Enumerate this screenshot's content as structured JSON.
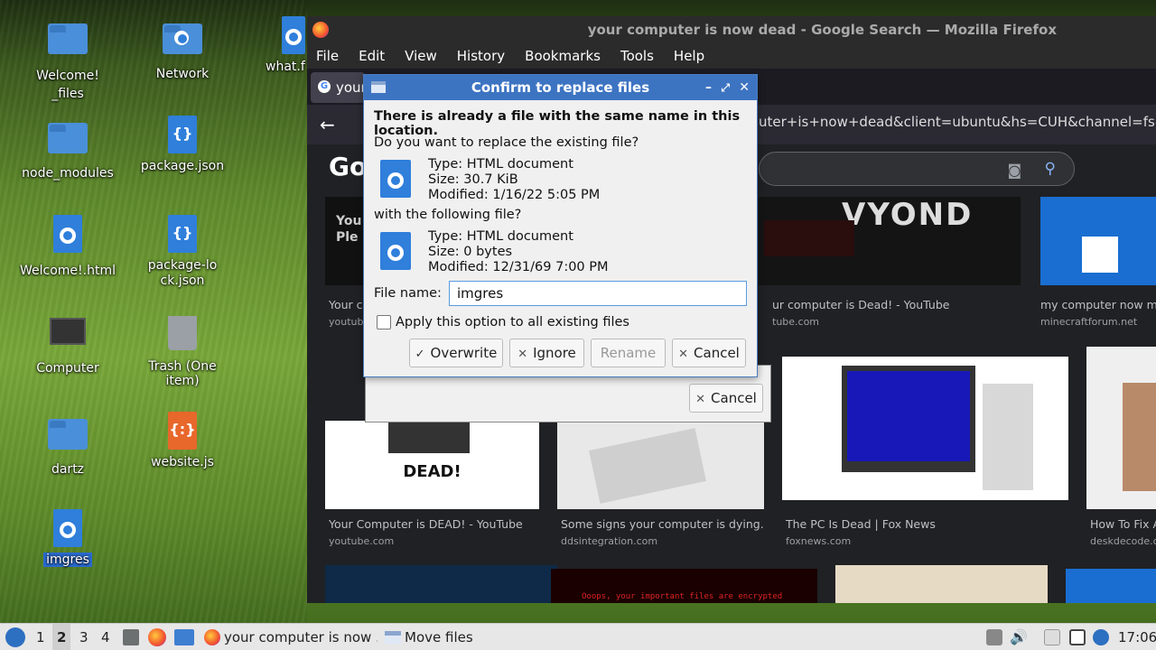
{
  "desktop": {
    "icons": [
      {
        "label": "Welcome!\n_files"
      },
      {
        "label": "Network"
      },
      {
        "label": "what.f"
      },
      {
        "label": "node_modules"
      },
      {
        "label": "package.json"
      },
      {
        "label": "Welcome!.html"
      },
      {
        "label": "package-lock.json"
      },
      {
        "label": "Computer"
      },
      {
        "label": "Trash (One item)"
      },
      {
        "label": "dartz"
      },
      {
        "label": "website.js"
      },
      {
        "label": "imgres"
      }
    ]
  },
  "firefox": {
    "title": "your computer is now dead - Google Search — Mozilla Firefox",
    "menu": [
      "File",
      "Edit",
      "View",
      "History",
      "Bookmarks",
      "Tools",
      "Help"
    ],
    "tab_label": "your",
    "url_fragment": "uter+is+now+dead&client=ubuntu&hs=CUH&channel=fs&s",
    "google_logo": "Go",
    "results_row1": [
      {
        "title": "Your co",
        "source": "youtube",
        "thumb_text": "You\nPle"
      },
      {
        "title": "ur computer is Dead! - YouTube",
        "source": "tube.com",
        "thumb_text": "VYOND"
      },
      {
        "title": "my computer now my F",
        "source": "minecraftforum.net",
        "thumb_text": ""
      }
    ],
    "results_row2": [
      {
        "title": "Your Computer is DEAD! - YouTube",
        "source": "youtube.com",
        "thumb_text": "DEAD!"
      },
      {
        "title": "Some signs your computer is dying...or...",
        "source": "ddsintegration.com",
        "thumb_text": ""
      },
      {
        "title": "The PC Is Dead | Fox News",
        "source": "foxnews.com",
        "thumb_text": ""
      },
      {
        "title": "How To Fix A",
        "source": "deskdecode.com",
        "thumb_text": ""
      }
    ],
    "bottom_thumb_text": "Ooops, your important files are encrypted"
  },
  "move_dialog": {
    "cancel_label": "Cancel"
  },
  "confirm_dialog": {
    "title": "Confirm to replace files",
    "headline": "There is already a file with the same name in this location.",
    "question": "Do you want to replace the existing file?",
    "existing": {
      "type": "Type: HTML document",
      "size": "Size: 30.7 KiB",
      "modified": "Modified: 1/16/22 5:05 PM"
    },
    "with_label": "with the following file?",
    "incoming": {
      "type": "Type: HTML document",
      "size": "Size: 0 bytes",
      "modified": "Modified: 12/31/69 7:00 PM"
    },
    "filename_label": "File name:",
    "filename_value": "imgres",
    "apply_all_label": "Apply this option to all existing files",
    "buttons": {
      "overwrite": "Overwrite",
      "ignore": "Ignore",
      "rename": "Rename",
      "cancel": "Cancel"
    }
  },
  "taskbar": {
    "workspaces": [
      "1",
      "2",
      "3",
      "4"
    ],
    "active_workspace": "2",
    "windows": [
      {
        "label": "your computer is now ..."
      },
      {
        "label": "Move files"
      }
    ],
    "clock": "17:06"
  },
  "colors": {
    "dialog_title_bg": "#3d74c2",
    "desktop_selection": "#2a6bd0",
    "folder_blue": "#4a8fd9"
  }
}
